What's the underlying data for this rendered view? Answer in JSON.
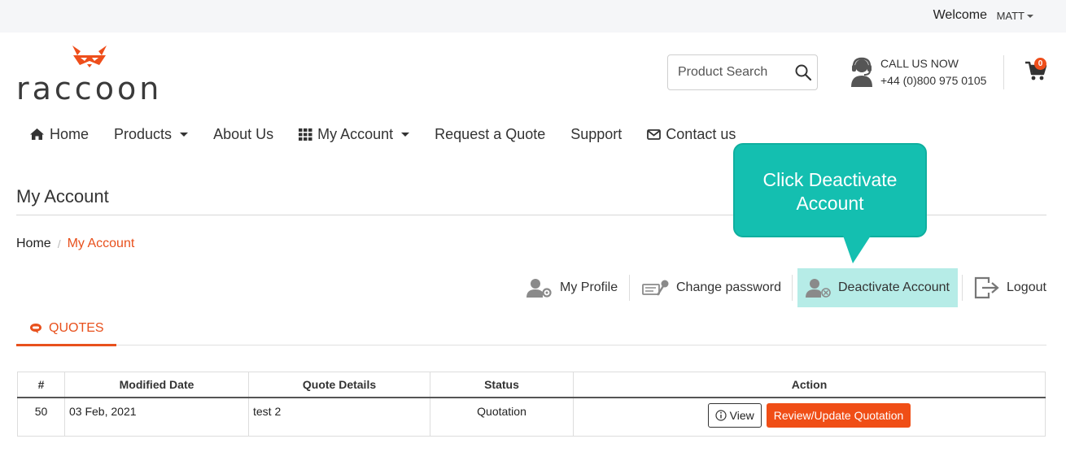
{
  "topbar": {
    "welcome": "Welcome",
    "user": "MATT"
  },
  "brand": {
    "name": "raccoon",
    "accent": "#ee4e1b"
  },
  "search": {
    "placeholder": "Product Search",
    "icon": "search-icon"
  },
  "contact": {
    "title": "CALL US NOW",
    "phone": "+44 (0)800 975 0105",
    "icon": "headset-icon"
  },
  "cart": {
    "count": "0",
    "icon": "cart-icon"
  },
  "nav": {
    "items": [
      {
        "label": "Home",
        "icon": "home-icon"
      },
      {
        "label": "Products",
        "dropdown": true
      },
      {
        "label": "About Us"
      },
      {
        "label": "My Account",
        "icon": "grid-icon",
        "dropdown": true
      },
      {
        "label": "Request a Quote"
      },
      {
        "label": "Support"
      },
      {
        "label": "Contact us",
        "icon": "envelope-icon"
      }
    ]
  },
  "page": {
    "title": "My Account"
  },
  "breadcrumb": {
    "home": "Home",
    "separator": "/",
    "current": "My Account"
  },
  "tooltip": {
    "line1": "Click Deactivate",
    "line2": "Account",
    "color": "#14bfb0"
  },
  "account_menu": {
    "items": [
      {
        "label": "My Profile",
        "icon": "user-settings-icon"
      },
      {
        "label": "Change password",
        "icon": "password-key-icon"
      },
      {
        "label": "Deactivate Account",
        "icon": "user-remove-icon",
        "active": true
      },
      {
        "label": "Logout",
        "icon": "logout-icon"
      }
    ],
    "active_color": "#b6ece7"
  },
  "tabs": {
    "quotes": "QUOTES"
  },
  "table": {
    "columns": [
      "#",
      "Modified Date",
      "Quote Details",
      "Status",
      "Action"
    ],
    "rows": [
      {
        "num": "50",
        "date": "03 Feb, 2021",
        "details": "test 2",
        "status": "Quotation",
        "view_label": "View",
        "review_label": "Review/Update Quotation"
      }
    ]
  }
}
